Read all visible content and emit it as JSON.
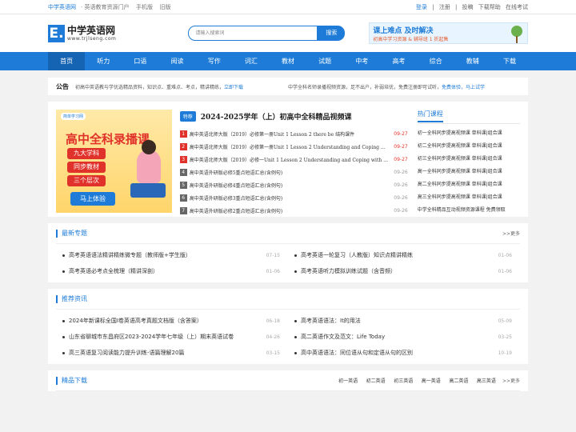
{
  "topbar": {
    "site": "中学英语网",
    "slogan": "· 英语教育资源门户",
    "mobile": "手机版",
    "old": "旧版",
    "login": "登录",
    "register": "注册",
    "submit": "投稿",
    "help": "下载帮助",
    "exam": "在线考试",
    "sep": "|"
  },
  "logo": {
    "mark": "E.",
    "cn": "中学英语网",
    "en": "www.trjlseng.com"
  },
  "search": {
    "placeholder": "请输入搜索词",
    "button": "搜索"
  },
  "ad": {
    "t1": "课上难点 及时解决",
    "t2": "初高中学习资源 & 辅导班 1 折起售"
  },
  "nav": [
    "首页",
    "听力",
    "口语",
    "阅读",
    "写作",
    "词汇",
    "教材",
    "试题",
    "中考",
    "高考",
    "综合",
    "教辅",
    "下载"
  ],
  "notice": {
    "label": "公告",
    "text": "初高中英语教与学优选精品资料，知识点、重难点、考点，精讲精练，",
    "link": "立即下载",
    "text2": "中学全科名师录播视频资源，足不出户，补弱培优，免费注册即可试听，",
    "link2": "免费体验，马上试学"
  },
  "promo": {
    "brand": "简单学习网",
    "title": "高中全科录播课",
    "tags": [
      "九大学科",
      "同步教材",
      "三个层次"
    ],
    "cta": "马上体验"
  },
  "course": {
    "badge": "特荐",
    "title": "2024-2025学年（上）初高中全科精品视频课",
    "items": [
      {
        "n": "1",
        "text": "高中英语北师大版（2019）必修第一册Unit 1 Lesson 2 there be 结构课件",
        "date": "09-27"
      },
      {
        "n": "2",
        "text": "高中英语北师大版（2019）必修第一册Unit 1 Lesson 2 Understanding and Coping with Stress课件",
        "date": "09-27"
      },
      {
        "n": "3",
        "text": "高中英语北师大版（2019）必修一Unit 1 Lesson 2 Understanding and Coping with Stress",
        "date": "09-27"
      },
      {
        "n": "4",
        "text": "高中英语外研版必修5重点短语汇总(含例句)",
        "date": "09-26"
      },
      {
        "n": "5",
        "text": "高中英语外研版必修4重点短语汇总(含例句)",
        "date": "09-26"
      },
      {
        "n": "6",
        "text": "高中英语外研版必修3重点短语汇总(含例句)",
        "date": "09-26"
      },
      {
        "n": "7",
        "text": "高中英语外研版必修2重点短语汇总(含例句)",
        "date": "09-26"
      }
    ]
  },
  "hot": {
    "title": "热门课程",
    "items": [
      "初一全科同步提高视频课 单科课|组合课",
      "初二全科同步提高视频课 单科课|组合课",
      "初三全科同步提高视频课 单科课|组合课",
      "高一全科同步提高视频课 单科课|组合课",
      "高二全科同步提高视频课 单科课|组合课",
      "高三全科同步提高视频课 单科课|组合课",
      "中学全科精品互动视频资源课程 免费领取"
    ]
  },
  "latest": {
    "title": "最新专题",
    "more": ">>更多",
    "items": [
      {
        "text": "高考英语语法精讲精练微专题（教师版+学生版）",
        "date": "07-15"
      },
      {
        "text": "高考英语一轮复习（人教版）知识点精讲精练",
        "date": "01-06"
      },
      {
        "text": "高考英语必考点全梳理（精讲深剖）",
        "date": "01-06"
      },
      {
        "text": "高考英语听力模拟训练试题（含音频）",
        "date": "01-06"
      }
    ]
  },
  "recommend": {
    "title": "推荐资讯",
    "items": [
      {
        "text": "2024年新课标全国Ⅰ卷英语高考真题文档版（含答案）",
        "date": "06-18"
      },
      {
        "text": "高考英语语法：It的用法",
        "date": "05-09"
      },
      {
        "text": "山东省聊城市东昌府区2023-2024学年七年级（上）期末英语试卷",
        "date": "04-26"
      },
      {
        "text": "高二英语作文及范文：Life Today",
        "date": "03-25"
      },
      {
        "text": "高三英语复习阅读能力提升训练-语篇理解20篇",
        "date": "03-15"
      },
      {
        "text": "高中英语语法：同位语从句和定语从句的区别",
        "date": "10-19"
      }
    ]
  },
  "download": {
    "title": "精品下载",
    "tabs": [
      "初一英语",
      "初二英语",
      "初三英语",
      "高一英语",
      "高二英语",
      "高三英语"
    ],
    "more": ">>更多"
  }
}
